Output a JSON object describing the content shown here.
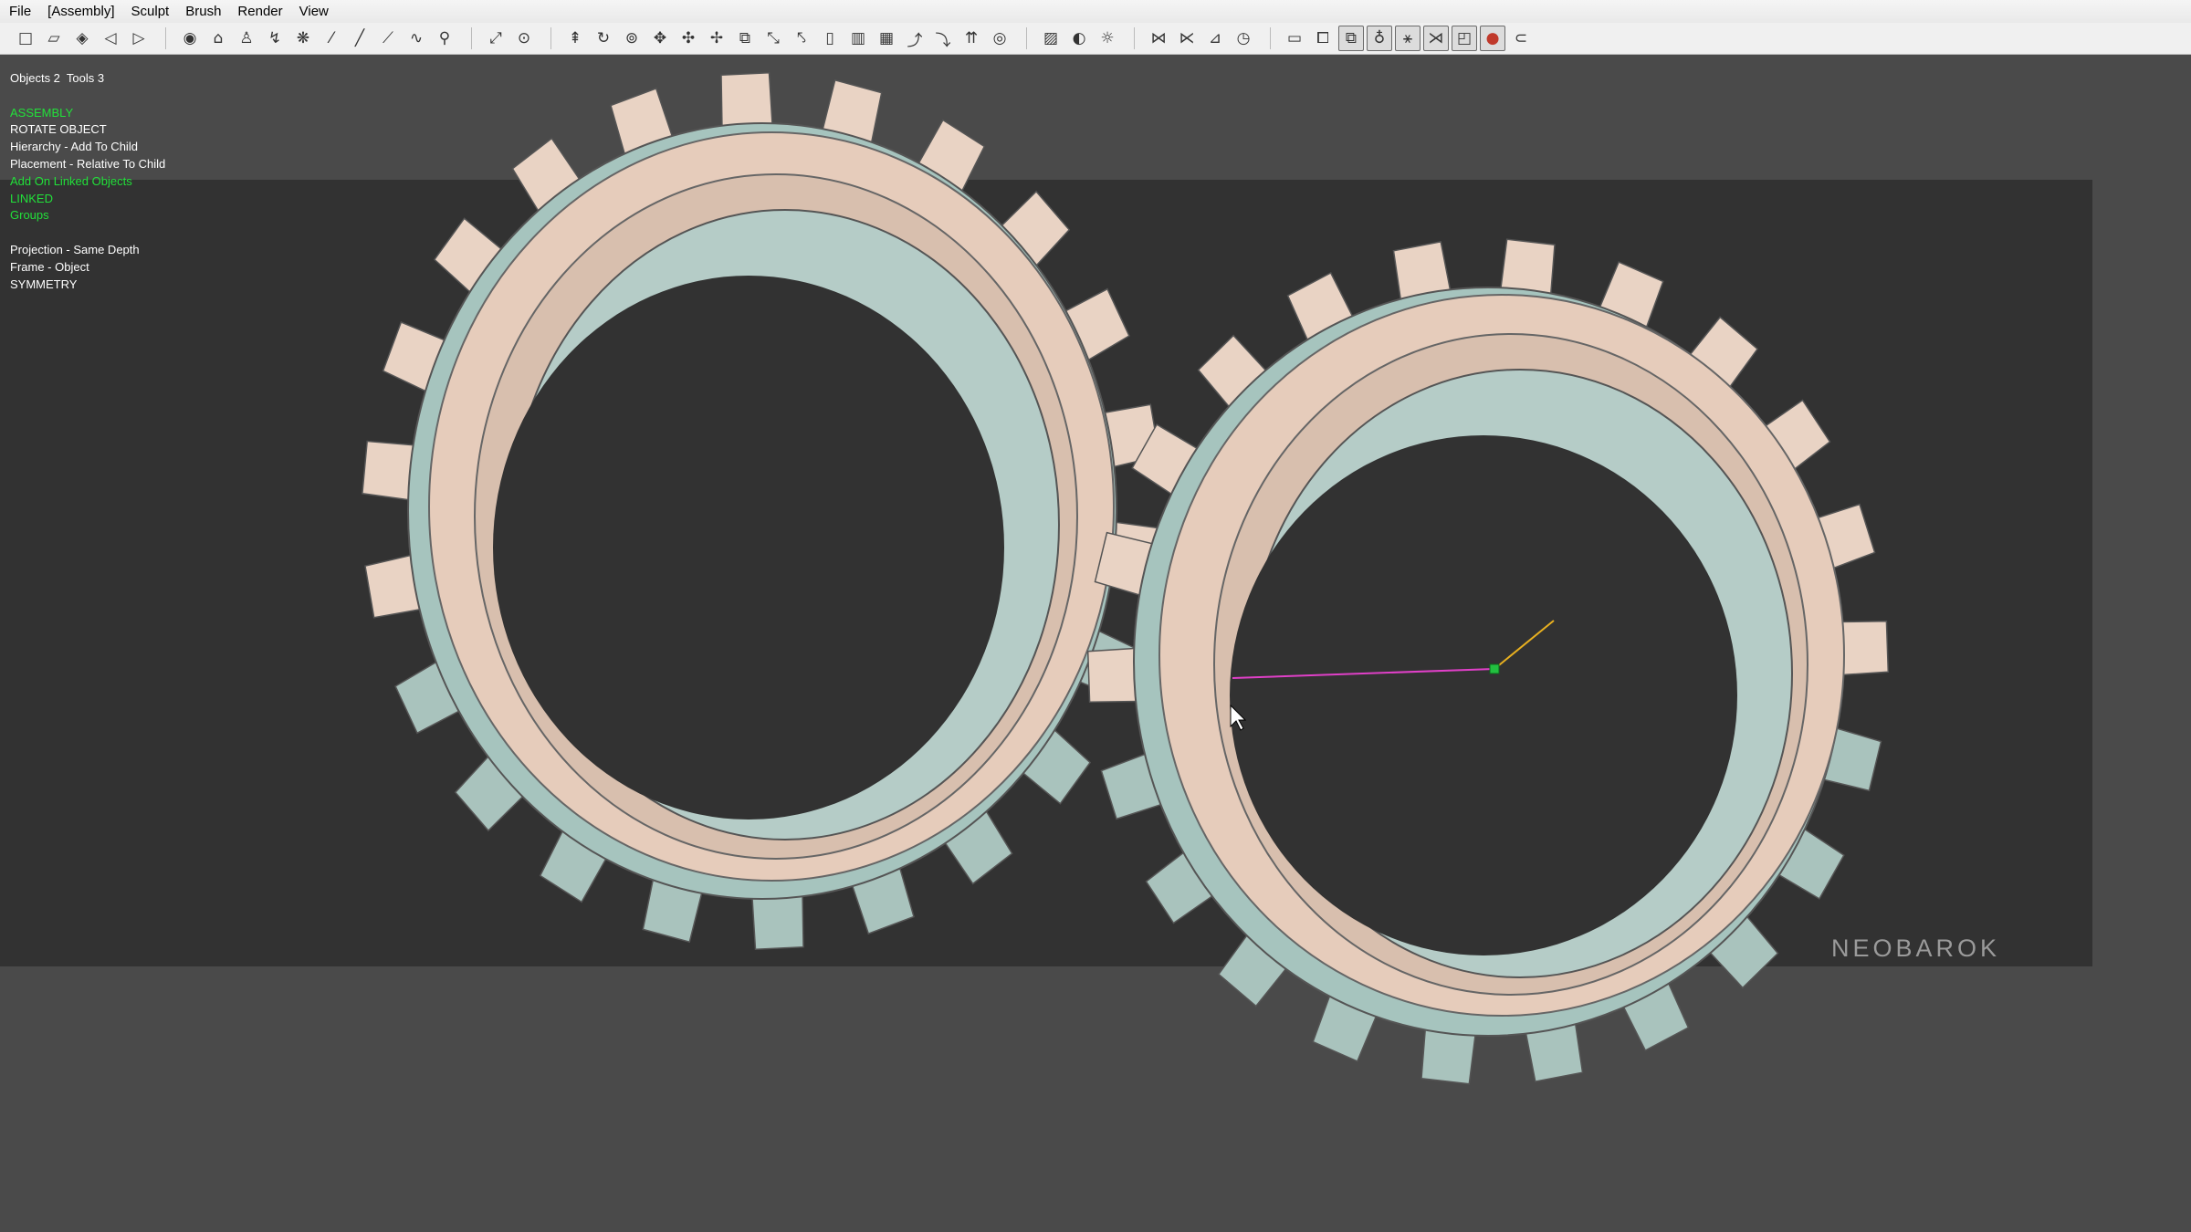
{
  "menu": [
    "File",
    "[Assembly]",
    "Sculpt",
    "Brush",
    "Render",
    "View"
  ],
  "toolbar": {
    "group1": [
      "new-icon",
      "open-icon",
      "lattice-icon",
      "undo-icon",
      "redo-icon"
    ],
    "group2": [
      "sphere-icon",
      "clay-icon",
      "inflate-icon",
      "pinch-icon",
      "smooth-icon",
      "line-icon",
      "brush-icon",
      "stroke-icon",
      "curve-icon",
      "stamp-icon"
    ],
    "group3": [
      "pick-icon",
      "center-icon"
    ],
    "group4": [
      "pin-icon",
      "rotate-icon",
      "orbit-icon",
      "move-icon",
      "move-cross-icon",
      "pan-icon",
      "scale-icon",
      "bend-icon",
      "twist-icon",
      "flatten-icon",
      "columns-icon",
      "grid-icon",
      "snake-icon",
      "warp-icon",
      "align-icon",
      "target-icon"
    ],
    "group5": [
      "hatch-icon",
      "contrast-icon",
      "light-icon"
    ],
    "group6": [
      "link-icon",
      "unlink-icon",
      "chart-icon",
      "clock-icon"
    ],
    "group7": [
      "frame-icon",
      "copy-icon",
      "bool-icon",
      "sculpt-icon",
      "mirror-icon",
      "join-icon",
      "layer-icon",
      "color-icon",
      "loop-icon"
    ]
  },
  "status": {
    "counts": "Objects 2  Tools 3",
    "mode": "ASSEMBLY",
    "action": "ROTATE OBJECT",
    "hierarchy": "Hierarchy - Add To Child",
    "placement": "Placement - Relative To Child",
    "linked_objects": "Add On Linked Objects",
    "linked": "LINKED",
    "groups": "Groups",
    "projection": "Projection - Same Depth",
    "frame": "Frame - Object",
    "symmetry": "SYMMETRY"
  },
  "watermark": "NEOBAROK",
  "colors": {
    "ring_top": "#e7cdbd",
    "ring_side": "#b8d2cc",
    "highlight_green": "#22e03a",
    "gizmo_magenta": "#e040c8",
    "gizmo_yellow": "#e8b020"
  }
}
